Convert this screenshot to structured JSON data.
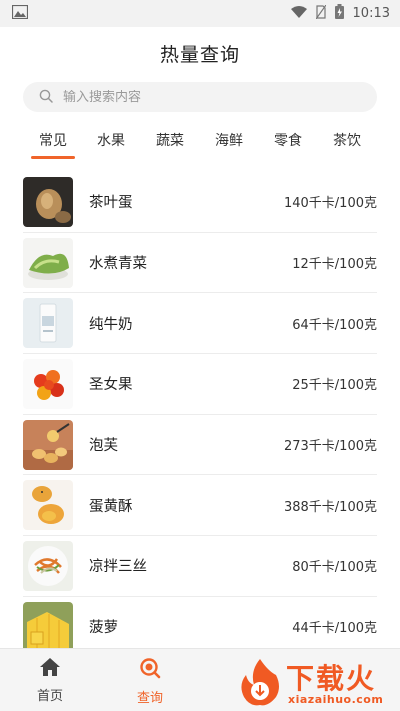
{
  "status_bar": {
    "time": "10:13"
  },
  "header": {
    "title": "热量查询"
  },
  "search": {
    "placeholder": "输入搜索内容"
  },
  "tabs": [
    {
      "label": "常见",
      "active": true
    },
    {
      "label": "水果",
      "active": false
    },
    {
      "label": "蔬菜",
      "active": false
    },
    {
      "label": "海鲜",
      "active": false
    },
    {
      "label": "零食",
      "active": false
    },
    {
      "label": "茶饮",
      "active": false
    }
  ],
  "foods": [
    {
      "name": "茶叶蛋",
      "calories": "140千卡/100克",
      "image": "tea-egg"
    },
    {
      "name": "水煮青菜",
      "calories": "12千卡/100克",
      "image": "boiled-greens"
    },
    {
      "name": "纯牛奶",
      "calories": "64千卡/100克",
      "image": "milk"
    },
    {
      "name": "圣女果",
      "calories": "25千卡/100克",
      "image": "cherry-tomatoes"
    },
    {
      "name": "泡芙",
      "calories": "273千卡/100克",
      "image": "cream-puffs"
    },
    {
      "name": "蛋黄酥",
      "calories": "388千卡/100克",
      "image": "egg-yolk-pastry"
    },
    {
      "name": "凉拌三丝",
      "calories": "80千卡/100克",
      "image": "shredded-salad"
    },
    {
      "name": "菠萝",
      "calories": "44千卡/100克",
      "image": "pineapple"
    }
  ],
  "bottom_nav": [
    {
      "label": "首页",
      "icon": "home-icon",
      "active": false
    },
    {
      "label": "查询",
      "icon": "search-icon",
      "active": true
    }
  ],
  "watermark": {
    "text": "下载火",
    "url_text": "xiazaihuo.com"
  },
  "colors": {
    "accent": "#f0642a",
    "text": "#222222",
    "muted": "#9a9a9a"
  }
}
